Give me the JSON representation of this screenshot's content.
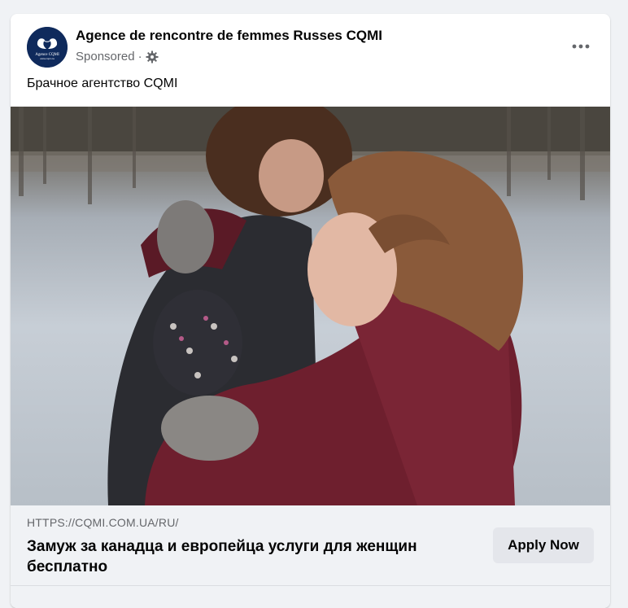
{
  "post": {
    "page_name": "Agence de rencontre de femmes Russes CQMI",
    "sponsored": "Sponsored",
    "separator": "·",
    "caption": "Брачное агентство CQMI",
    "avatar_brand": "Agence CQMI",
    "avatar_url": "www.cqmi.ca",
    "more_icon": "more-options-icon",
    "privacy_icon": "gear-icon"
  },
  "link": {
    "domain": "HTTPS://CQMI.COM.UA/RU/",
    "headline": "Замуж за канадца и европейца услуги для женщин бесплатно",
    "cta_label": "Apply Now"
  },
  "colors": {
    "card_bg": "#ffffff",
    "page_bg": "#f0f2f5",
    "secondary_text": "#65676b",
    "avatar_bg": "#0f2a5c",
    "coat": "#6e1f2e"
  }
}
